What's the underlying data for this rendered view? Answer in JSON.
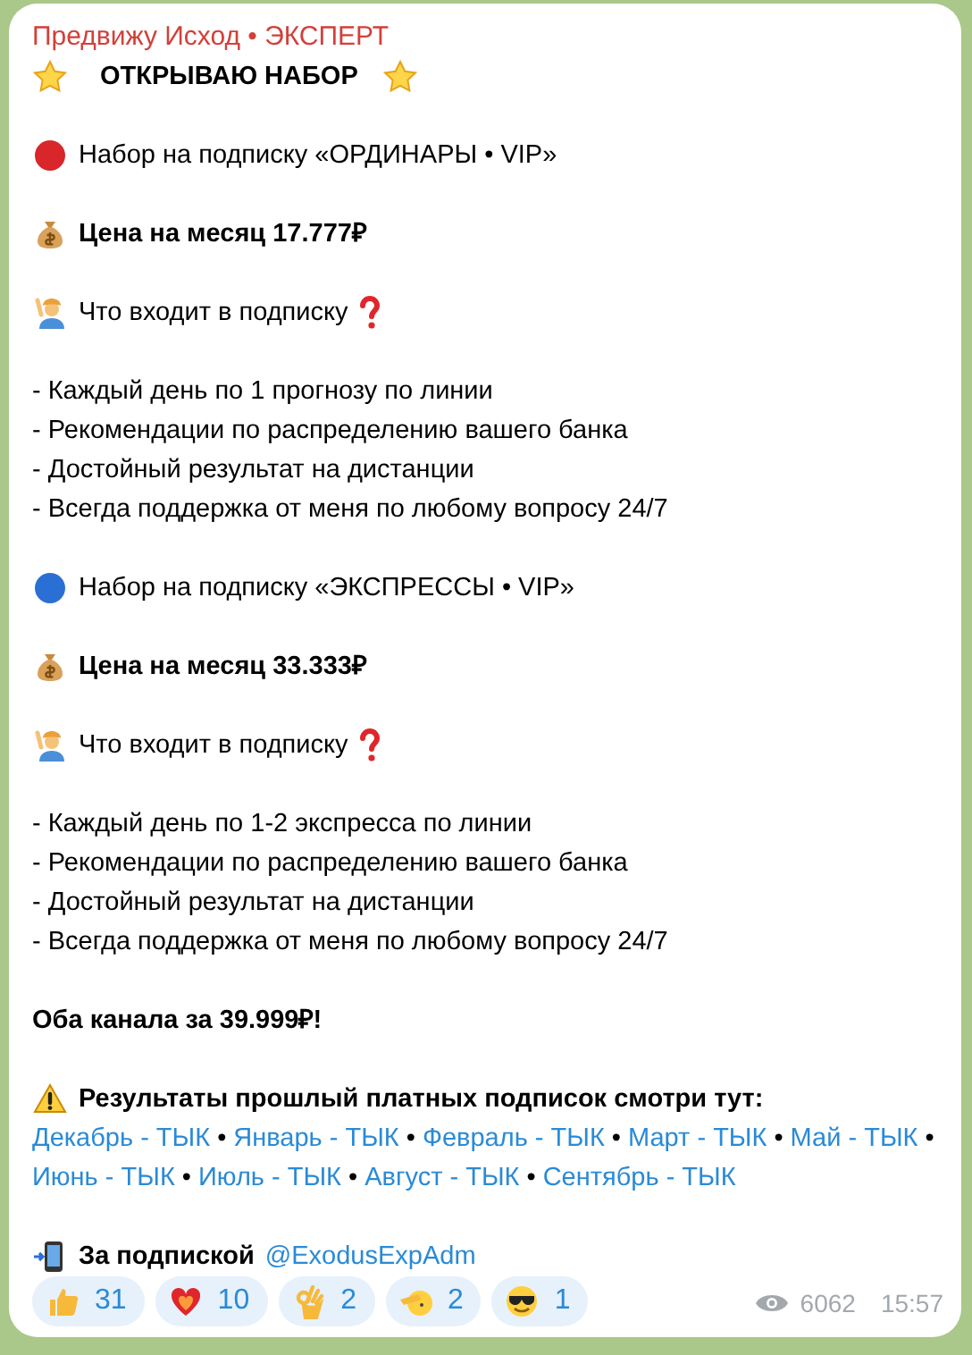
{
  "message": {
    "author": "Предвижу Исход • ЭКСПЕРТ",
    "paragraphs": [
      {
        "kind": "headline",
        "text": "ОТКРЫВАЮ НАБОР"
      },
      {
        "kind": "offer",
        "color": "#d8262b",
        "text": "Набор на подписку «ОРДИНАРЫ • VIP»"
      },
      {
        "kind": "price",
        "text": "Цена на месяц 17.777₽"
      },
      {
        "kind": "includes",
        "text": "Что входит в подписку"
      },
      {
        "kind": "list",
        "items": [
          "- Каждый день по 1 прогнозу по линии",
          "- Рекомендации по распределению вашего банка",
          "- Достойный результат на дистанции",
          "- Всегда поддержка от меня по любому вопросу 24/7"
        ]
      },
      {
        "kind": "offer",
        "color": "#2a6fd4",
        "text": "Набор на подписку «ЭКСПРЕССЫ • VIP»"
      },
      {
        "kind": "price",
        "text": "Цена на месяц 33.333₽"
      },
      {
        "kind": "includes",
        "text": "Что входит в подписку"
      },
      {
        "kind": "list",
        "items": [
          "- Каждый день по 1-2 экспресса по линии",
          "- Рекомендации по распределению вашего банка",
          "- Достойный результат на дистанции",
          "- Всегда поддержка от меня по любому вопросу 24/7"
        ]
      },
      {
        "kind": "total",
        "text": "Оба канала за 39.999₽!"
      },
      {
        "kind": "results",
        "text": "Результаты прошлый платных подписок смотри тут:",
        "links": [
          {
            "label": "Декабрь - ТЫК",
            "separator": "•"
          },
          {
            "label": "Январь - ТЫК",
            "separator": "•"
          },
          {
            "label": "Февраль - ТЫК",
            "separator": "•"
          },
          {
            "label": "Март - ТЫК",
            "separator": "•"
          },
          {
            "label": "Май - ТЫК",
            "separator": "•"
          },
          {
            "label": "Июнь - ТЫК",
            "separator": "•"
          },
          {
            "label": "Июль - ТЫК",
            "separator": "•"
          },
          {
            "label": "Август - ТЫК",
            "separator": "•"
          },
          {
            "label": "Сентябрь - ТЫК"
          }
        ]
      },
      {
        "kind": "contact",
        "text": "За подпиской",
        "link": "@ExodusExpAdm"
      }
    ],
    "reactions": [
      {
        "kind": "thumbs",
        "count": "31"
      },
      {
        "kind": "heart",
        "count": "10"
      },
      {
        "kind": "ok",
        "count": "2"
      },
      {
        "kind": "salute",
        "count": "2"
      },
      {
        "kind": "cool",
        "count": "1"
      }
    ],
    "views": "6062",
    "time": "15:57"
  }
}
